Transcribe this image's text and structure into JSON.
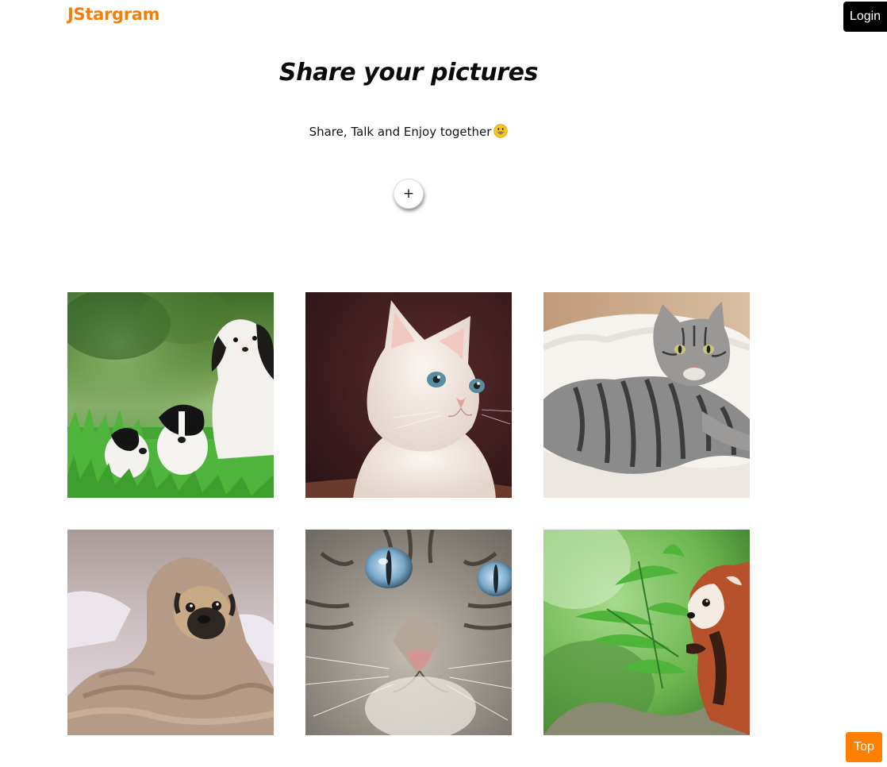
{
  "header": {
    "brand": "JStargram",
    "login_label": "Login"
  },
  "hero": {
    "title": "Share your pictures",
    "subtitle": "Share, Talk and Enjoy together",
    "subtitle_icon": "grinning-face-emoji",
    "add_label": "+"
  },
  "gallery": {
    "items": [
      {
        "subject": "puppies-in-grass"
      },
      {
        "subject": "white-kitten"
      },
      {
        "subject": "tabby-cat-on-rug"
      },
      {
        "subject": "pug-in-blanket"
      },
      {
        "subject": "cat-face-closeup"
      },
      {
        "subject": "red-panda-bamboo"
      }
    ]
  },
  "footer": {
    "top_label": "Top"
  },
  "colors": {
    "brand": "#f47e0a",
    "top_button": "#ff7f00",
    "login_button": "#000000"
  }
}
